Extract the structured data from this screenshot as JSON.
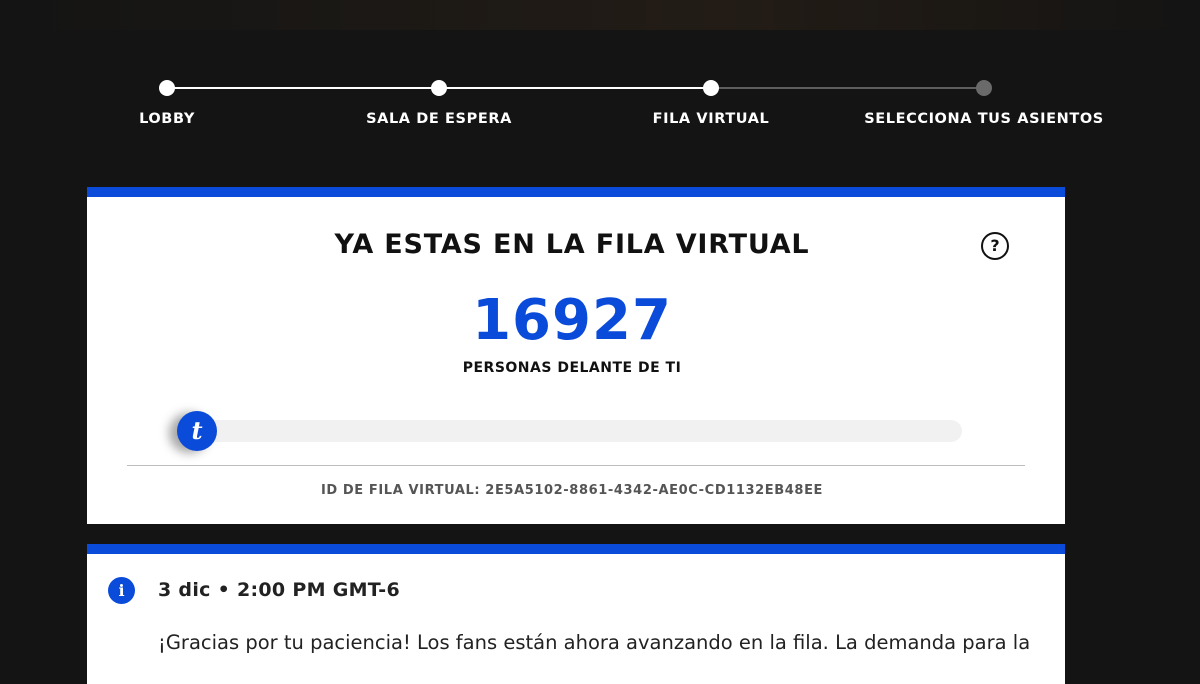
{
  "stepper": {
    "steps": [
      {
        "label": "LOBBY",
        "state": "done"
      },
      {
        "label": "SALA DE ESPERA",
        "state": "done"
      },
      {
        "label": "FILA VIRTUAL",
        "state": "current"
      },
      {
        "label": "SELECCIONA TUS ASIENTOS",
        "state": "todo"
      }
    ]
  },
  "queue": {
    "title": "YA ESTAS EN LA FILA VIRTUAL",
    "help_icon": "?",
    "people_ahead": "16927",
    "people_ahead_label": "PERSONAS DELANTE DE TI",
    "progress_fraction": 0.02,
    "progress_icon": "t",
    "queue_id": "ID DE FILA VIRTUAL: 2E5A5102-8861-4342-AE0C-CD1132EB48EE"
  },
  "info": {
    "icon": "i",
    "date": "3 dic • 2:00 PM GMT-6",
    "message": "¡Gracias por tu paciencia! Los fans están ahora avanzando en la fila. La demanda para la"
  },
  "colors": {
    "accent": "#0a4bd9",
    "background": "#141414",
    "card": "#ffffff",
    "step_done": "#ffffff",
    "step_todo": "#6a6a6a"
  }
}
